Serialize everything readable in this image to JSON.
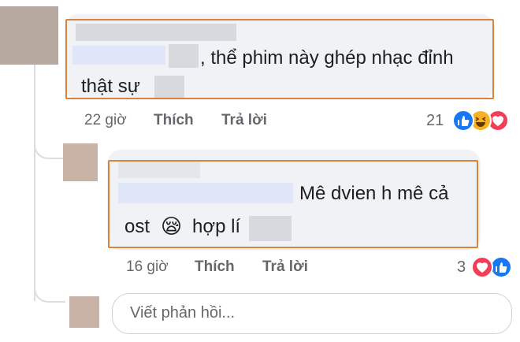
{
  "comment": {
    "text_line1": ", thể phim này ghép nhạc đỉnh",
    "text_line2": "thật sự",
    "time": "22 giờ",
    "like_label": "Thích",
    "reply_label": "Trả lời",
    "reaction_count": "21",
    "reactions": [
      "like-icon",
      "haha-icon",
      "love-icon"
    ]
  },
  "reply": {
    "text_line1": "Mê dvien h mê cả",
    "text_line2_before": "ost",
    "emoji": "😪",
    "text_line2_after": "hợp lí",
    "time": "16 giờ",
    "like_label": "Thích",
    "reply_label": "Trả lời",
    "reaction_count": "3",
    "reactions": [
      "love-icon",
      "like-icon"
    ]
  },
  "reply_box": {
    "placeholder": "Viết phản hồi..."
  },
  "colors": {
    "highlight_frame": "#d9843b",
    "like_blue": "#1877f2",
    "love_red": "#f33e58",
    "haha_yellow": "#f7b125"
  }
}
